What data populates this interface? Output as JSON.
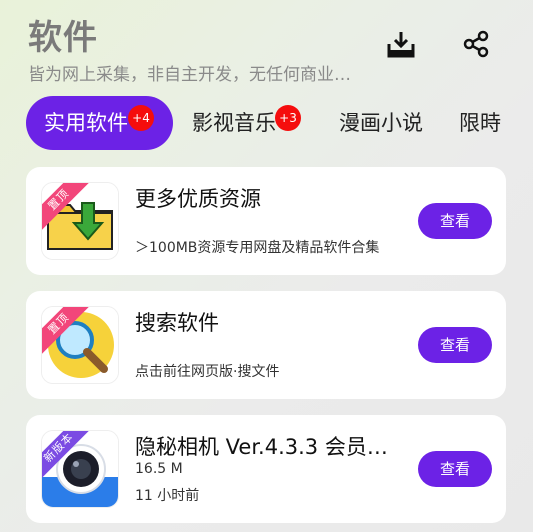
{
  "header": {
    "title": "软件",
    "subtitle": "皆为网上采集，非自主开发，无任何商业…",
    "download_icon": "download-tray-icon",
    "share_icon": "share-icon"
  },
  "tabs": [
    {
      "label": "实用软件",
      "badge": "+4",
      "active": true
    },
    {
      "label": "影视音乐",
      "badge": "+3",
      "active": false
    },
    {
      "label": "漫画小说",
      "badge": "",
      "active": false
    },
    {
      "label": "限時",
      "badge": "",
      "active": false
    }
  ],
  "apps": [
    {
      "name": "更多优质资源",
      "ribbon": "置顶",
      "size": "",
      "desc": "＞100MB资源专用网盘及精品软件合集",
      "button": "查看",
      "icon": "folder-download-icon"
    },
    {
      "name": "搜索软件",
      "ribbon": "置顶",
      "size": "",
      "desc": "点击前往网页版·搜文件",
      "button": "查看",
      "icon": "magnifier-icon"
    },
    {
      "name": "隐秘相机 Ver.4.3.3 会员版…",
      "ribbon": "新版本",
      "size": "16.5 M",
      "desc": "11 小时前",
      "button": "查看",
      "icon": "camera-icon"
    }
  ],
  "colors": {
    "accent": "#6c22e6",
    "badge": "#f50d0d",
    "ribbon_pink": "#f2467a",
    "ribbon_purple": "#7b4be3"
  }
}
